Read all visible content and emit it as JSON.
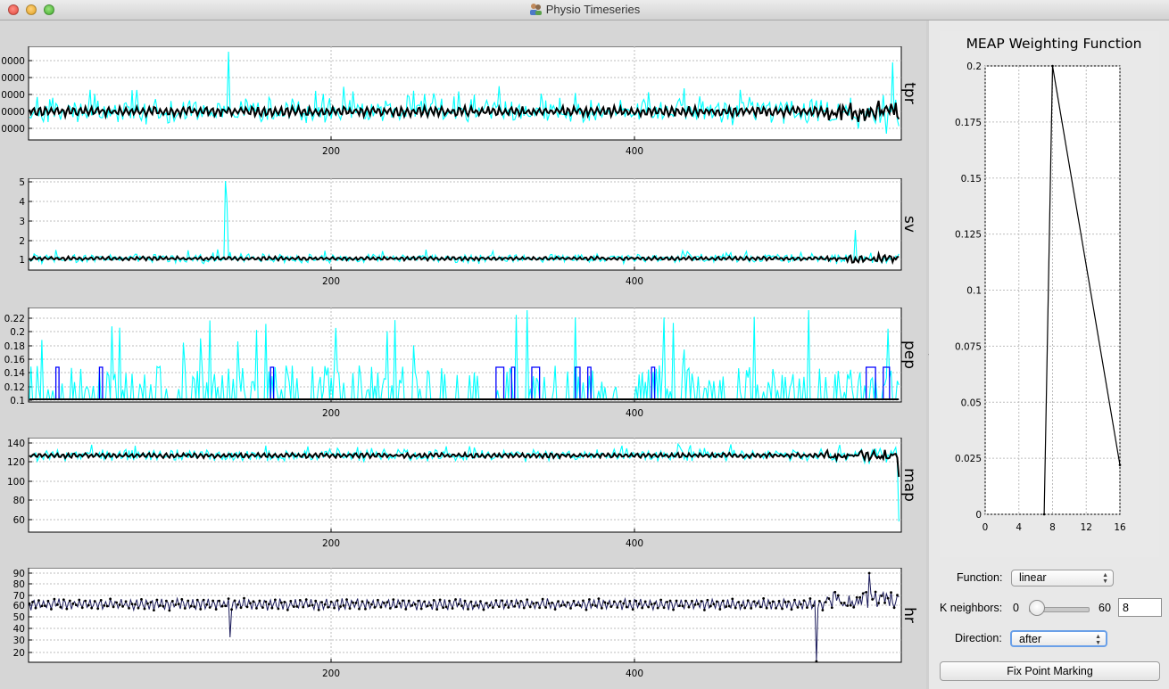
{
  "window": {
    "title": "Physio Timeseries"
  },
  "colors": {
    "raw": "#00ffff",
    "smoothed": "#000000",
    "marked": "#0000ff",
    "grid": "#bdbdbd"
  },
  "plots": [
    {
      "id": "tpr",
      "ylabel": "tpr",
      "yticks": [
        "0000",
        "0000",
        "0000",
        "0000",
        "0000"
      ],
      "xticks": [
        "200",
        "400"
      ]
    },
    {
      "id": "sv",
      "ylabel": "sv",
      "yticks": [
        "1",
        "2",
        "3",
        "4",
        "5"
      ],
      "xticks": [
        "200",
        "400"
      ]
    },
    {
      "id": "pep",
      "ylabel": "pep",
      "yticks": [
        "0.1",
        "0.12",
        "0.14",
        "0.16",
        "0.18",
        "0.2",
        "0.22"
      ],
      "xticks": [
        "200",
        "400"
      ]
    },
    {
      "id": "map",
      "ylabel": "map",
      "yticks": [
        "60",
        "80",
        "100",
        "120",
        "140"
      ],
      "xticks": [
        "200",
        "400"
      ]
    },
    {
      "id": "hr",
      "ylabel": "hr",
      "yticks": [
        "20",
        "30",
        "40",
        "50",
        "60",
        "70",
        "80",
        "90"
      ],
      "xticks": [
        "200",
        "400"
      ]
    }
  ],
  "weighting": {
    "title": "MEAP Weighting Function",
    "yticks": [
      "0",
      "0.025",
      "0.05",
      "0.075",
      "0.1",
      "0.125",
      "0.15",
      "0.175",
      "0.2"
    ],
    "xticks": [
      "0",
      "4",
      "8",
      "12",
      "16"
    ]
  },
  "chart_data": {
    "type": "line",
    "title": "MEAP Weighting Function",
    "x": [
      7,
      8,
      16
    ],
    "series": [
      {
        "values": [
          0,
          0.2,
          0.022
        ]
      }
    ],
    "xlim": [
      0,
      16
    ],
    "ylim": [
      0,
      0.2
    ],
    "grid": true
  },
  "controls": {
    "function_label": "Function:",
    "function_value": "linear",
    "k_label": "K neighbors:",
    "k_min": "0",
    "k_max": "60",
    "k_value": "8",
    "k_fraction": 0.133,
    "direction_label": "Direction:",
    "direction_value": "after",
    "fix_button": "Fix Point Marking"
  }
}
